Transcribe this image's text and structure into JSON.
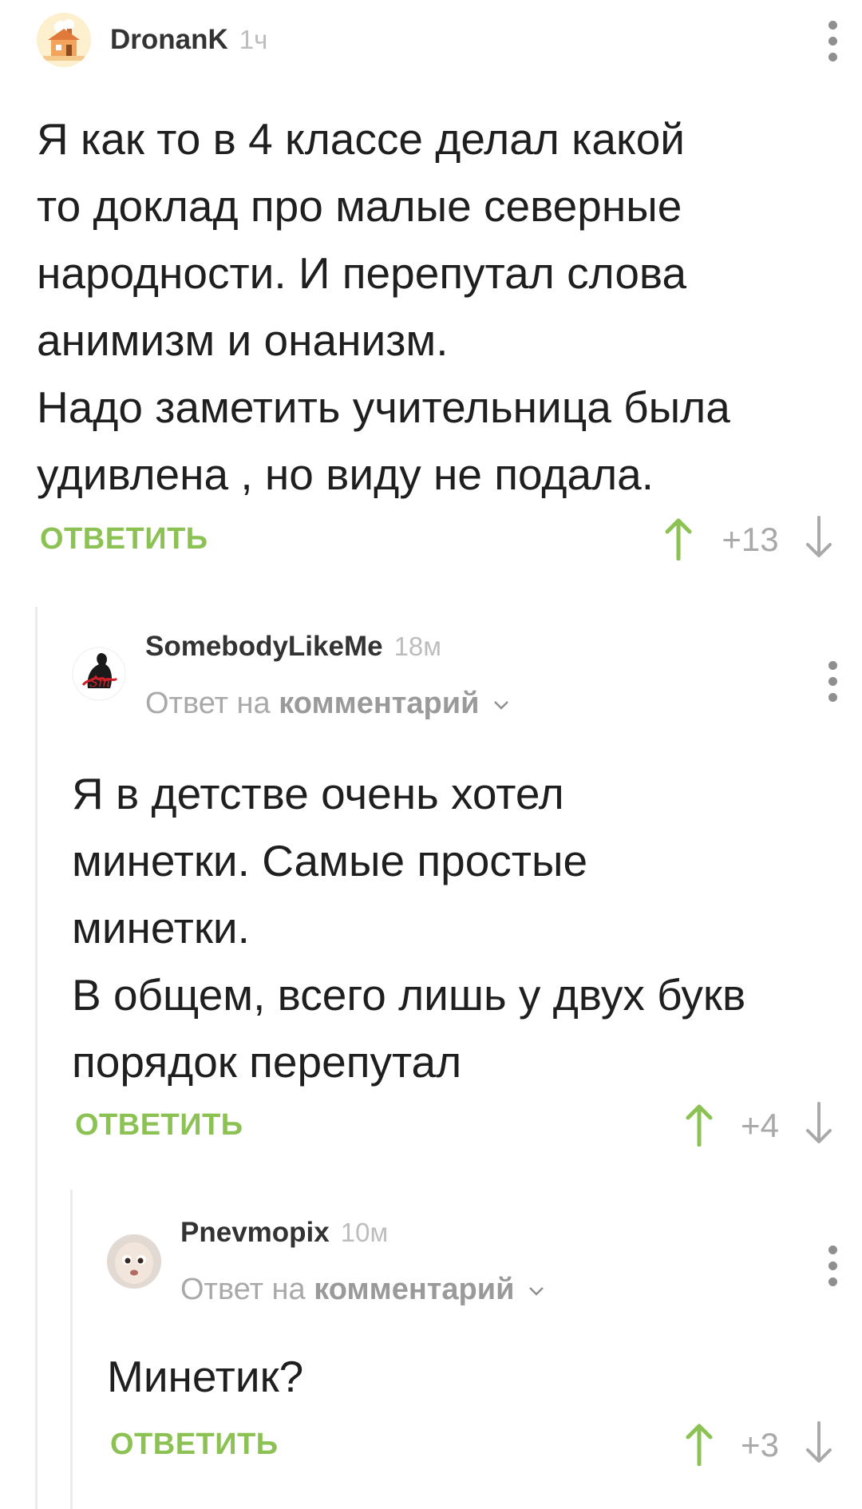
{
  "comments": [
    {
      "author": "DronanK",
      "time": "1ч",
      "text": "Я как то в 4 классе делал какой\nто доклад про малые северные\nнародности. И перепутал слова\nанимизм и онанизм.\nНадо заметить учительница была\nудивлена , но виду не подала.",
      "reply_label": "ОТВЕТИТЬ",
      "score": "+13"
    },
    {
      "author": "SomebodyLikeMe",
      "time": "18м",
      "reply_to_prefix": "Ответ на",
      "reply_to_link": "комментарий",
      "text": "Я в детстве очень хотел\nминетки. Самые простые\nминетки.\nВ общем, всего лишь у двух букв\nпорядок перепутал",
      "reply_label": "ОТВЕТИТЬ",
      "score": "+4"
    },
    {
      "author": "Pnevmopix",
      "time": "10м",
      "reply_to_prefix": "Ответ на",
      "reply_to_link": "комментарий",
      "text": "Минетик?",
      "reply_label": "ОТВЕТИТЬ",
      "score": "+3"
    }
  ],
  "colors": {
    "accent_green": "#8cc153",
    "muted_gray": "#a9a9a9",
    "thread_line": "#ececec"
  },
  "icons": [
    "avatar-cartoon-house",
    "avatar-silhouette-logo",
    "avatar-face-photo",
    "more-vert-icon",
    "upvote-arrow-icon",
    "downvote-arrow-icon",
    "chevron-down-icon"
  ]
}
